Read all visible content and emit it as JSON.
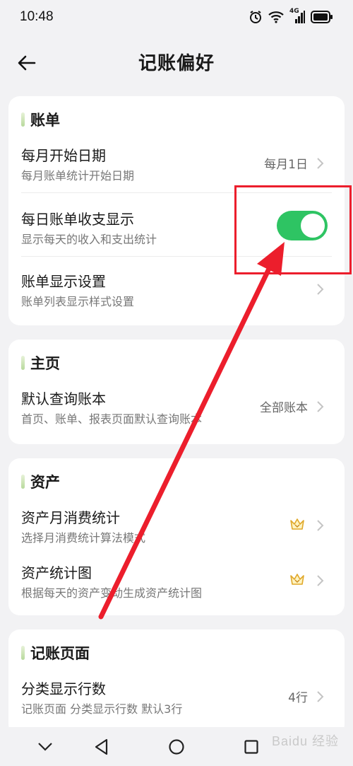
{
  "status_bar": {
    "time": "10:48",
    "network": "4G"
  },
  "header": {
    "title": "记账偏好"
  },
  "sections": [
    {
      "title": "账单",
      "rows": [
        {
          "title": "每月开始日期",
          "subtitle": "每月账单统计开始日期",
          "value": "每月1日"
        },
        {
          "title": "每日账单收支显示",
          "subtitle": "显示每天的收入和支出统计",
          "toggle_on": true
        },
        {
          "title": "账单显示设置",
          "subtitle": "账单列表显示样式设置"
        }
      ]
    },
    {
      "title": "主页",
      "rows": [
        {
          "title": "默认查询账本",
          "subtitle": "首页、账单、报表页面默认查询账本",
          "value": "全部账本"
        }
      ]
    },
    {
      "title": "资产",
      "rows": [
        {
          "title": "资产月消费统计",
          "subtitle": "选择月消费统计算法模式",
          "icon": "crown-icon"
        },
        {
          "title": "资产统计图",
          "subtitle": "根据每天的资产变动生成资产统计图",
          "icon": "crown-icon"
        }
      ]
    },
    {
      "title": "记账页面",
      "rows": [
        {
          "title": "分类显示行数",
          "subtitle": "记账页面 分类显示行数 默认3行",
          "value": "4行"
        }
      ]
    }
  ],
  "watermark": "Baidu 经验",
  "colors": {
    "toggle": "#2ec463",
    "annotation": "#ec1e2c",
    "background": "#f2f2f4"
  }
}
